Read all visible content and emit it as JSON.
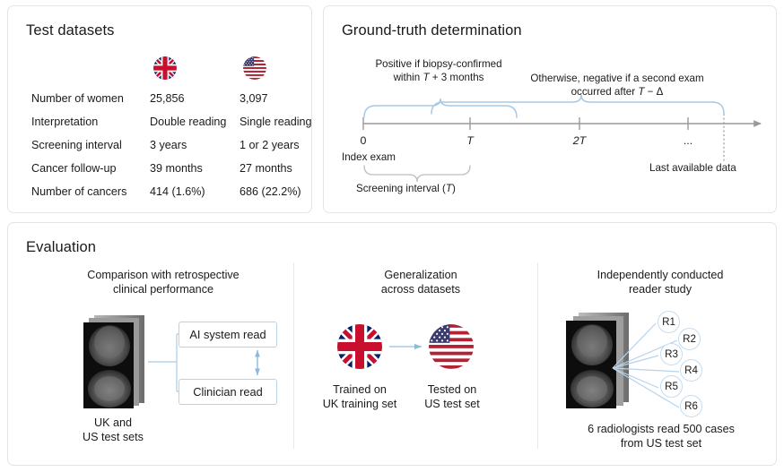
{
  "panels": {
    "datasets": {
      "title": "Test datasets",
      "columns": [
        {
          "icon": "uk-flag-icon",
          "name": "UK"
        },
        {
          "icon": "us-flag-icon",
          "name": "US"
        }
      ],
      "rows": [
        {
          "label": "Number of women",
          "uk": "25,856",
          "us": "3,097"
        },
        {
          "label": "Interpretation",
          "uk": "Double reading",
          "us": "Single reading"
        },
        {
          "label": "Screening interval",
          "uk": "3 years",
          "us": "1 or 2 years"
        },
        {
          "label": "Cancer follow-up",
          "uk": "39 months",
          "us": "27 months"
        },
        {
          "label": "Number of cancers",
          "uk": "414 (1.6%)",
          "us": "686 (22.2%)"
        }
      ]
    },
    "groundtruth": {
      "title": "Ground-truth determination",
      "positive_note_line1": "Positive if biopsy-confirmed",
      "positive_note_line2_pre": "within ",
      "positive_note_line2_italic": "T",
      "positive_note_line2_post": " + 3 months",
      "negative_note_line1": "Otherwise, negative if a second exam",
      "negative_note_line2_pre": "occurred after ",
      "negative_note_line2_italic": "T",
      "negative_note_line2_post": " − Δ",
      "ticks": [
        {
          "label": "0",
          "italic": false
        },
        {
          "label": "T",
          "italic": true
        },
        {
          "label": "2T",
          "italic": true
        },
        {
          "label": "...",
          "italic": false
        }
      ],
      "index_exam_label": "Index exam",
      "last_data_label": "Last available data",
      "screening_interval_pre": "Screening interval (",
      "screening_interval_italic": "T",
      "screening_interval_post": ")"
    },
    "evaluation": {
      "title": "Evaluation",
      "sections": [
        {
          "heading_line1": "Comparison with retrospective",
          "heading_line2": "clinical performance",
          "box_ai": "AI system read",
          "box_clinician": "Clinician read",
          "caption_line1": "UK and",
          "caption_line2": "US test sets"
        },
        {
          "heading_line1": "Generalization",
          "heading_line2": "across datasets",
          "left_caption_line1": "Trained on",
          "left_caption_line2": "UK training set",
          "right_caption_line1": "Tested on",
          "right_caption_line2": "US test set"
        },
        {
          "heading_line1": "Independently conducted",
          "heading_line2": "reader study",
          "readers": [
            "R1",
            "R2",
            "R3",
            "R4",
            "R5",
            "R6"
          ],
          "caption_line1": "6 radiologists read 500 cases",
          "caption_line2": "from US test set"
        }
      ]
    }
  },
  "colors": {
    "panel_border": "#e4e4e4",
    "accent_blue": "#a8c8e4",
    "axis_gray": "#9a9a9a",
    "text": "#1a1a1a",
    "flag_red": "#c8102e",
    "flag_blue": "#012169"
  }
}
